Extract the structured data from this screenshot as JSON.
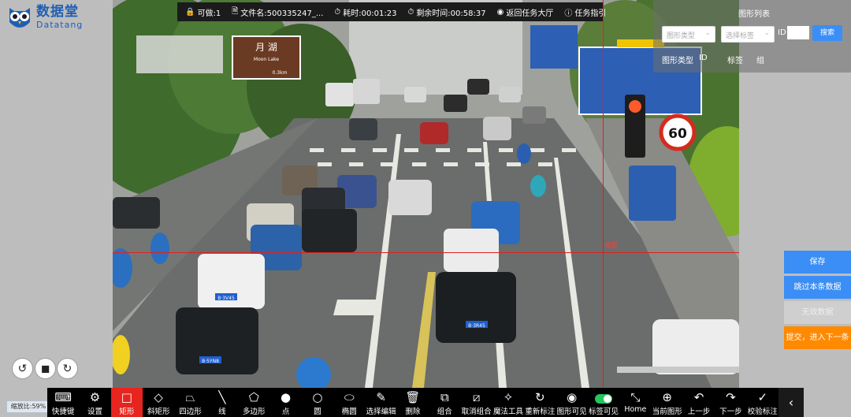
{
  "brand": {
    "name_cn": "数据堂",
    "name_en": "Datatang"
  },
  "infobar": {
    "items": [
      {
        "icon": "lock-icon",
        "glyph": "🔒",
        "text": "可做:1"
      },
      {
        "icon": "file-icon",
        "glyph": "🗎",
        "text": "文件名:500335247_..."
      },
      {
        "icon": "clock-icon",
        "glyph": "⏱",
        "text": "耗时:00:01:23"
      },
      {
        "icon": "timer-icon",
        "glyph": "⏱",
        "text": "剩余时间:00:58:37"
      },
      {
        "icon": "return-icon",
        "glyph": "◉",
        "text": "返回任务大厅"
      },
      {
        "icon": "guide-icon",
        "glyph": "ⓘ",
        "text": "任务指引"
      }
    ]
  },
  "shape_panel": {
    "title": "图形列表",
    "type_select": "图形类型",
    "label_select": "选择标签",
    "id_label": "ID",
    "id_value": "",
    "search_label": "搜索",
    "columns": [
      "图形类型",
      "ID",
      "标签",
      "组"
    ]
  },
  "actions": {
    "save": "保存",
    "skip": "跳过本条数据",
    "invalid": "无效数据",
    "submit": "提交，进入下一条"
  },
  "crosshair_label": "矩形",
  "zoom_label": "缩放比:59%",
  "scene": {
    "sign_cn": "月 湖",
    "sign_en": "Moon Lake",
    "sign_km": "0.3km",
    "speed_limit": "60",
    "plate_a": "B·3V45",
    "plate_b": "B·3R45",
    "plate_c": "B·5YN8"
  },
  "tools": [
    {
      "name": "shortcut",
      "icon": "keyboard-icon",
      "glyph": "⌨",
      "label": "快捷键",
      "active": false
    },
    {
      "name": "settings",
      "icon": "gear-icon",
      "glyph": "⚙",
      "label": "设置",
      "active": false
    },
    {
      "name": "rectangle",
      "icon": "rectangle-icon",
      "glyph": "□",
      "label": "矩形",
      "active": true
    },
    {
      "name": "oblique-rect",
      "icon": "diamond-icon",
      "glyph": "◇",
      "label": "斜矩形",
      "active": false
    },
    {
      "name": "quad",
      "icon": "quadrilateral-icon",
      "glyph": "⏢",
      "label": "四边形",
      "active": false
    },
    {
      "name": "line",
      "icon": "line-icon",
      "glyph": "╲",
      "label": "线",
      "active": false
    },
    {
      "name": "polygon",
      "icon": "polygon-icon",
      "glyph": "⬠",
      "label": "多边形",
      "active": false
    },
    {
      "name": "point",
      "icon": "point-icon",
      "glyph": "●",
      "label": "点",
      "active": false
    },
    {
      "name": "circle",
      "icon": "circle-icon",
      "glyph": "○",
      "label": "圆",
      "active": false
    },
    {
      "name": "ellipse",
      "icon": "ellipse-icon",
      "glyph": "⬭",
      "label": "椭圆",
      "active": false
    },
    {
      "name": "select-edit",
      "icon": "edit-icon",
      "glyph": "✎",
      "label": "选择编辑",
      "active": false
    },
    {
      "name": "delete",
      "icon": "trash-icon",
      "glyph": "🗑",
      "label": "删除",
      "active": false
    },
    {
      "name": "group",
      "icon": "group-icon",
      "glyph": "⧉",
      "label": "组合",
      "active": false
    },
    {
      "name": "ungroup",
      "icon": "ungroup-icon",
      "glyph": "⧄",
      "label": "取消组合",
      "active": false
    },
    {
      "name": "magic",
      "icon": "magic-wand-icon",
      "glyph": "✧",
      "label": "魔法工具",
      "active": false
    },
    {
      "name": "relabel",
      "icon": "refresh-icon",
      "glyph": "↻",
      "label": "重新标注",
      "active": false
    },
    {
      "name": "shape-visible",
      "icon": "eye-icon",
      "glyph": "◉",
      "label": "图形可见",
      "active": false
    },
    {
      "name": "label-visible",
      "icon": "toggle-icon",
      "glyph": "",
      "label": "标签可见",
      "active": false,
      "toggle": true
    },
    {
      "name": "home",
      "icon": "fullscreen-icon",
      "glyph": "⤡",
      "label": "Home",
      "active": false
    },
    {
      "name": "current-shape",
      "icon": "target-icon",
      "glyph": "⊕",
      "label": "当前图形",
      "active": false
    },
    {
      "name": "prev",
      "icon": "undo-icon",
      "glyph": "↶",
      "label": "上一步",
      "active": false
    },
    {
      "name": "next",
      "icon": "redo-icon",
      "glyph": "↷",
      "label": "下一步",
      "active": false
    },
    {
      "name": "verify",
      "icon": "verify-icon",
      "glyph": "✓",
      "label": "校验标注",
      "active": false
    }
  ],
  "colors": {
    "primary": "#3a8ef6",
    "active_tool": "#e8241f",
    "submit": "#ff8a00",
    "invalid": "#cfcfcf"
  }
}
